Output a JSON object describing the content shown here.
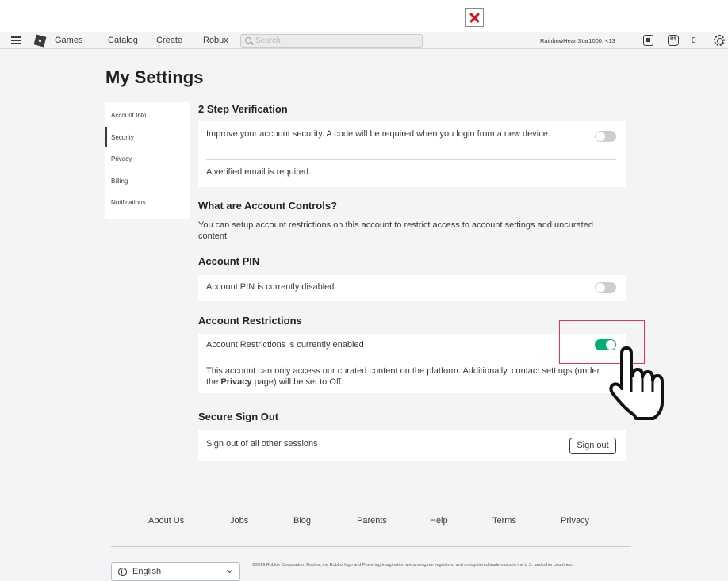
{
  "nav": {
    "links": [
      "Games",
      "Catalog",
      "Create",
      "Robux"
    ],
    "search_placeholder": "Search",
    "username": "RainbowHeartStar1000: <13",
    "robux_icon_label": "R$",
    "robux_count": "0"
  },
  "page_title": "My Settings",
  "sidenav": {
    "items": [
      "Account Info",
      "Security",
      "Privacy",
      "Billing",
      "Notifications"
    ],
    "active": "Security"
  },
  "two_step": {
    "title": "2 Step Verification",
    "description": "Improve your account security. A code will be required when you login from a new device.",
    "note": "A verified email is required.",
    "enabled": false
  },
  "account_controls": {
    "title": "What are Account Controls?",
    "description": "You can setup account restrictions on this account to restrict access to account settings and uncurated content"
  },
  "account_pin": {
    "title": "Account PIN",
    "status": "Account PIN is currently disabled",
    "enabled": false
  },
  "account_restrictions": {
    "title": "Account Restrictions",
    "status": "Account Restrictions is currently enabled",
    "enabled": true,
    "info_before": "This account can only access our curated content on the platform. Additionally, contact settings (under the ",
    "info_link": "Privacy",
    "info_after": " page) will be set to Off."
  },
  "secure_signout": {
    "title": "Secure Sign Out",
    "description": "Sign out of all other sessions",
    "button": "Sign out"
  },
  "footer": {
    "links": [
      "About Us",
      "Jobs",
      "Blog",
      "Parents",
      "Help",
      "Terms",
      "Privacy"
    ],
    "language": "English",
    "copyright": "©2019 Roblox Corporation. Roblox, the Roblox logo and Powering Imagination are among our registered and unregistered trademarks in the U.S. and other countries."
  },
  "colors": {
    "toggle_on": "#00b06f",
    "toggle_off": "#ccced0",
    "highlight": "#e9305e",
    "close_x": "#d8121b"
  }
}
